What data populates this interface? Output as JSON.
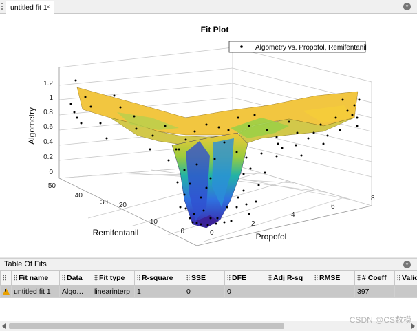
{
  "tab": {
    "label": "untitled fit 1",
    "close_glyph": "×"
  },
  "plot": {
    "title": "Fit Plot",
    "legend": "Algometry vs. Propofol, Remifentanil",
    "zlabel": "Algometry",
    "xlabel": "Propofol",
    "ylabel": "Remifentanil",
    "z_ticks": [
      "0",
      "0.2",
      "0.4",
      "0.6",
      "0.8",
      "1",
      "1.2"
    ],
    "x_ticks": [
      "0",
      "2",
      "4",
      "6",
      "8"
    ],
    "y_ticks": [
      "0",
      "10",
      "20",
      "30",
      "40",
      "50"
    ],
    "surface_colors": {
      "low": "#3a2db0",
      "mid": "#22b4a0",
      "high": "#f5c83c"
    }
  },
  "table": {
    "title": "Table Of Fits",
    "columns": [
      "Fit name",
      "Data",
      "Fit type",
      "R-square",
      "SSE",
      "DFE",
      "Adj R-sq",
      "RMSE",
      "# Coeff",
      "Valid"
    ],
    "rows": [
      {
        "fit_name": "untitled fit 1",
        "data": "Algometry...",
        "fit_type": "linearinterp",
        "r_square": "1",
        "sse": "0",
        "dfe": "0",
        "adj_r_sq": "",
        "rmse": "",
        "coeff": "397",
        "valid": ""
      }
    ]
  },
  "watermark": "CSDN @CS数模"
}
